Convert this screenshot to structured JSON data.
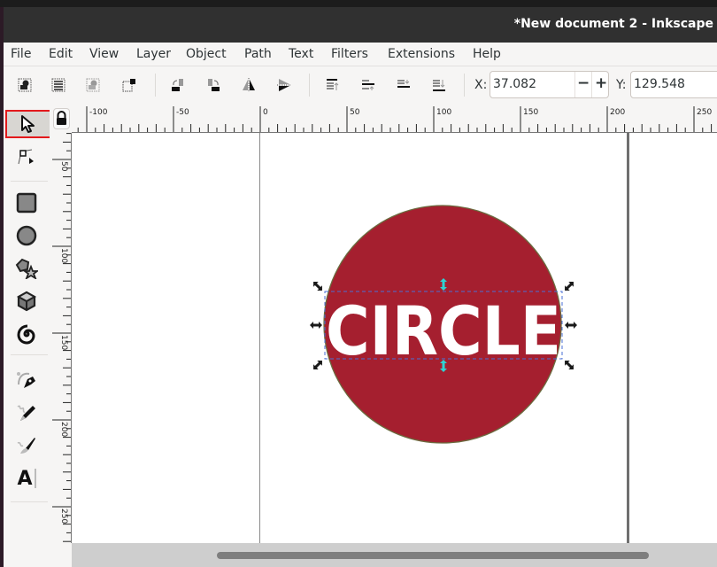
{
  "window": {
    "title": "*New document 2 - Inkscape"
  },
  "menu": [
    "File",
    "Edit",
    "View",
    "Layer",
    "Object",
    "Path",
    "Text",
    "Filters",
    "Extensions",
    "Help"
  ],
  "toolbar": {
    "icons": [
      "select-all-icon",
      "select-all-in-all-layers-icon",
      "deselect-icon",
      "select-same-icon",
      "rotate-ccw-icon",
      "rotate-cw-icon",
      "flip-horizontal-icon",
      "flip-vertical-icon",
      "raise-to-top-icon",
      "raise-icon",
      "lower-icon",
      "lower-to-bottom-icon"
    ],
    "x_label": "X:",
    "x_value": "37.082",
    "minus": "−",
    "plus": "+",
    "y_label": "Y:",
    "y_value": "129.548"
  },
  "tools": {
    "items": [
      "selector-tool",
      "node-tool",
      "rectangle-tool",
      "ellipse-tool",
      "star-polygon-tool",
      "3d-box-tool",
      "spiral-tool",
      "pen-tool",
      "pencil-tool",
      "calligraphy-tool",
      "text-tool"
    ],
    "active": "selector-tool",
    "text_tool_glyph": "A"
  },
  "rulers": {
    "horizontal_labels": [
      "-100",
      "-50",
      "0",
      "50",
      "100",
      "150",
      "200",
      "250"
    ],
    "vertical_labels": [
      "50",
      "100",
      "150",
      "200",
      "250"
    ]
  },
  "canvas": {
    "circle_fill": "#a51f2f",
    "circle_stroke": "#6b6a3e",
    "text": "CIRCLE",
    "text_color": "#ffffff",
    "selection_handle_color": "#1a1a1a",
    "center_handle_color": "#2ed3d3"
  },
  "colors": {
    "active_tool_outline": "#e3191c"
  }
}
